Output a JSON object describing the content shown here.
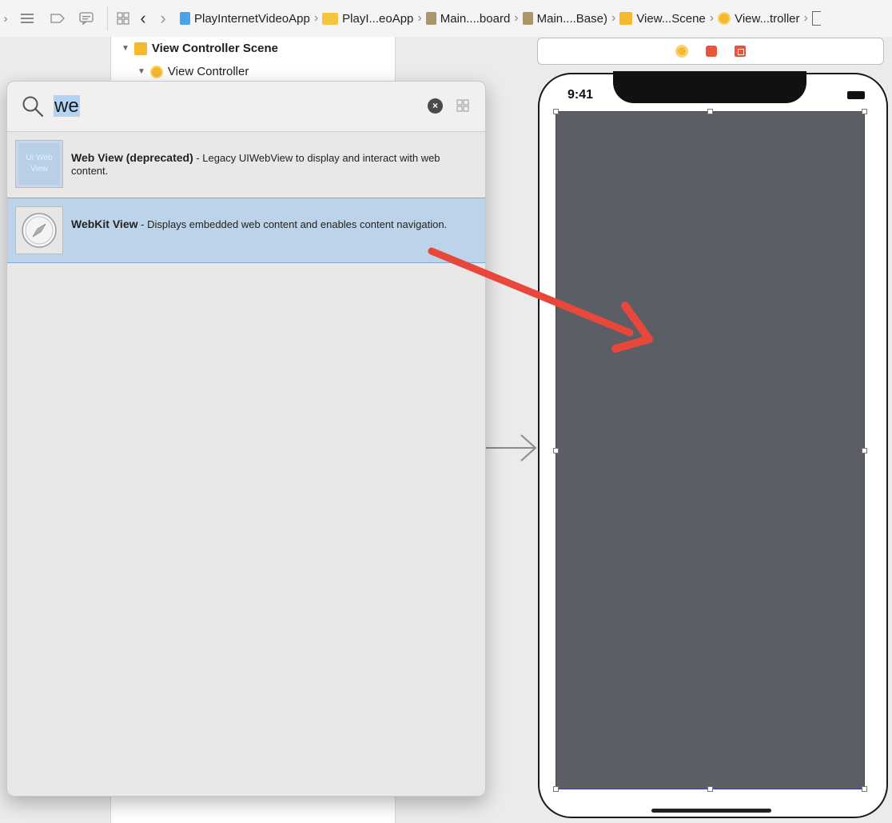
{
  "topbar": {
    "breadcrumbs": [
      {
        "label": "PlayInternetVideoApp",
        "icon": "project-file-icon"
      },
      {
        "label": "PlayI...eoApp",
        "icon": "folder-icon"
      },
      {
        "label": "Main....board",
        "icon": "storyboard-file-icon"
      },
      {
        "label": "Main....Base)",
        "icon": "storyboard-file-icon"
      },
      {
        "label": "View...Scene",
        "icon": "scene-icon"
      },
      {
        "label": "View...troller",
        "icon": "view-controller-icon"
      }
    ]
  },
  "outline": {
    "scene_label": "View Controller Scene",
    "controller_label": "View Controller"
  },
  "library": {
    "search_value": "we",
    "items": [
      {
        "title": "Web View (deprecated)",
        "description": " - Legacy UIWebView to display and interact with web content.",
        "thumb_text": "UI Web View",
        "selected": false
      },
      {
        "title": "WebKit View",
        "description": " - Displays embedded web content and enables content navigation.",
        "thumb_text": "",
        "selected": true
      }
    ]
  },
  "device": {
    "status_time": "9:41"
  },
  "colors": {
    "selection": "#bcd3ea",
    "canvas_view": "#5b5e64",
    "annotation_arrow": "#e8473b"
  }
}
